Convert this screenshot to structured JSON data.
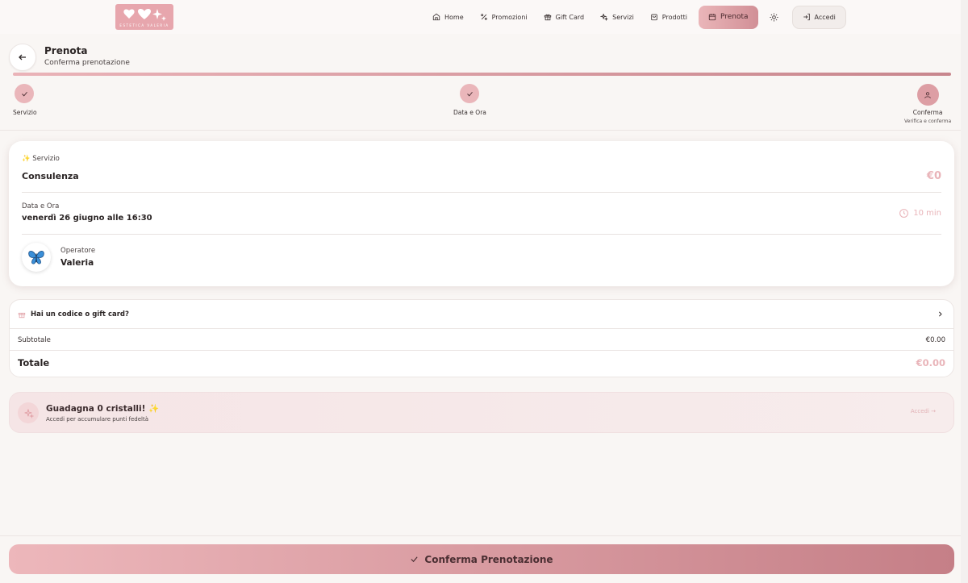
{
  "brand": {
    "logo_text": "ESTETICA VALERIA"
  },
  "nav": {
    "items": [
      {
        "label": "Home",
        "icon": "home-icon"
      },
      {
        "label": "Promozioni",
        "icon": "percent-icon"
      },
      {
        "label": "Gift Card",
        "icon": "gift-icon"
      },
      {
        "label": "Servizi",
        "icon": "sparkles-icon"
      },
      {
        "label": "Prodotti",
        "icon": "shopping-bag-icon"
      },
      {
        "label": "Prenota",
        "icon": "calendar-icon",
        "active": true
      }
    ],
    "theme_icon": "sun-icon",
    "login_label": "Accedi"
  },
  "page": {
    "title": "Prenota",
    "subtitle": "Conferma prenotazione"
  },
  "steps": [
    {
      "label": "Servizio",
      "status": "done"
    },
    {
      "label": "Data e Ora",
      "status": "done"
    },
    {
      "label": "Conferma",
      "sub": "Verifica e conferma",
      "status": "current"
    }
  ],
  "summary": {
    "service_label": "Servizio",
    "service_emoji": "✨",
    "service_name": "Consulenza",
    "service_price": "€0",
    "datetime_label": "Data e Ora",
    "datetime_value": "venerdì 26 giugno alle 16:30",
    "duration": "10 min",
    "operator_label": "Operatore",
    "operator_name": "Valeria"
  },
  "payment": {
    "code_prompt": "Hai un codice o gift card?",
    "subtotal_label": "Subtotale",
    "subtotal_value": "€0.00",
    "total_label": "Totale",
    "total_value": "€0.00"
  },
  "loyalty": {
    "title": "Guadagna 0 cristalli!",
    "title_emoji": "✨",
    "subtitle": "Accedi per accumulare punti fedeltà",
    "link": "Accedi →"
  },
  "cta": {
    "label": "Conferma Prenotazione"
  },
  "colors": {
    "accent": "#e7a6ad",
    "accent_dark": "#c57f87",
    "bg": "#f9f6f4"
  }
}
